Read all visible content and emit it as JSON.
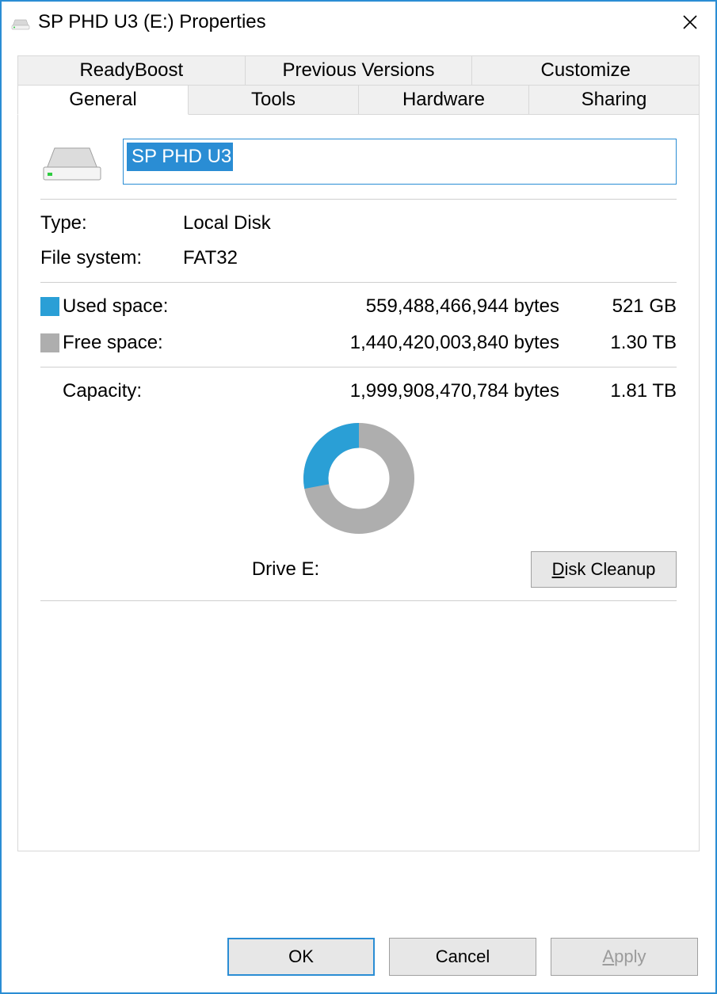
{
  "window": {
    "title": "SP PHD U3 (E:) Properties"
  },
  "tabs": {
    "row1": [
      "ReadyBoost",
      "Previous Versions",
      "Customize"
    ],
    "row2": [
      "General",
      "Tools",
      "Hardware",
      "Sharing"
    ],
    "active": "General"
  },
  "general": {
    "drive_name": "SP PHD U3",
    "type_label": "Type:",
    "type_value": "Local Disk",
    "fs_label": "File system:",
    "fs_value": "FAT32",
    "used_label": "Used space:",
    "used_bytes": "559,488,466,944 bytes",
    "used_hr": "521 GB",
    "free_label": "Free space:",
    "free_bytes": "1,440,420,003,840 bytes",
    "free_hr": "1.30 TB",
    "capacity_label": "Capacity:",
    "capacity_bytes": "1,999,908,470,784 bytes",
    "capacity_hr": "1.81 TB",
    "drive_label": "Drive E:",
    "disk_cleanup": "Disk Cleanup"
  },
  "buttons": {
    "ok": "OK",
    "cancel": "Cancel",
    "apply": "Apply"
  },
  "colors": {
    "used": "#2a9fd6",
    "free": "#aeaeae",
    "accent": "#2a8dd4"
  },
  "chart_data": {
    "type": "pie",
    "title": "Drive E:",
    "series": [
      {
        "name": "Used space",
        "value": 559488466944,
        "color": "#2a9fd6"
      },
      {
        "name": "Free space",
        "value": 1440420003840,
        "color": "#aeaeae"
      }
    ],
    "total": 1999908470784,
    "used_fraction": 0.28,
    "inner_radius_ratio": 0.55
  }
}
